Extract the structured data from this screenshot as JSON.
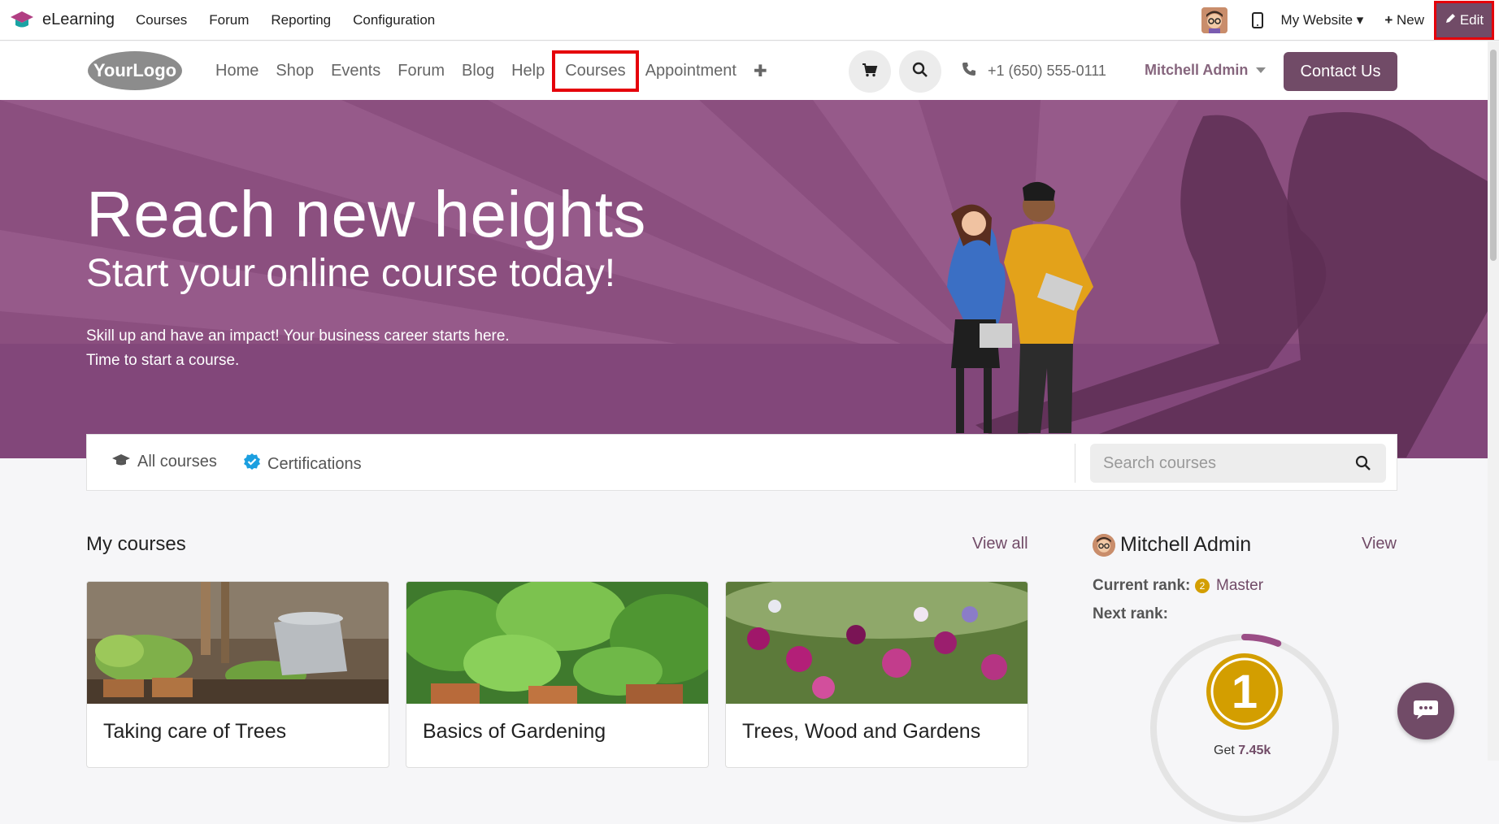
{
  "adminbar": {
    "app_name": "eLearning",
    "menu": [
      "Courses",
      "Forum",
      "Reporting",
      "Configuration"
    ],
    "my_website": "My Website",
    "new_label": "New",
    "edit_label": "Edit"
  },
  "sitenav": {
    "logo_text": "YourLogo",
    "links": [
      "Home",
      "Shop",
      "Events",
      "Forum",
      "Blog",
      "Help",
      "Courses",
      "Appointment"
    ],
    "phone": "+1 (650) 555-0111",
    "user": "Mitchell Admin",
    "contact_label": "Contact Us"
  },
  "hero": {
    "title": "Reach new heights",
    "subtitle": "Start your online course today!",
    "text1": "Skill up and have an impact! Your business career starts here.",
    "text2": "Time to start a course."
  },
  "filterbar": {
    "all_courses": "All courses",
    "certifications": "Certifications",
    "search_placeholder": "Search courses"
  },
  "mycourses": {
    "title": "My courses",
    "view_all": "View all",
    "cards": [
      {
        "title": "Taking care of Trees"
      },
      {
        "title": "Basics of Gardening"
      },
      {
        "title": "Trees, Wood and Gardens"
      }
    ]
  },
  "profile": {
    "name": "Mitchell Admin",
    "view_label": "View",
    "current_rank_label": "Current rank:",
    "current_rank": "Master",
    "current_rank_badge": "2",
    "next_rank_label": "Next rank:",
    "next_rank_badge": "1",
    "karma_prefix": "Get",
    "karma_value": "7.45k",
    "progress_fraction": 0.06
  },
  "colors": {
    "brand": "#714b67",
    "hero_bg": "#8b4f7f",
    "highlight": "#e5000a"
  }
}
